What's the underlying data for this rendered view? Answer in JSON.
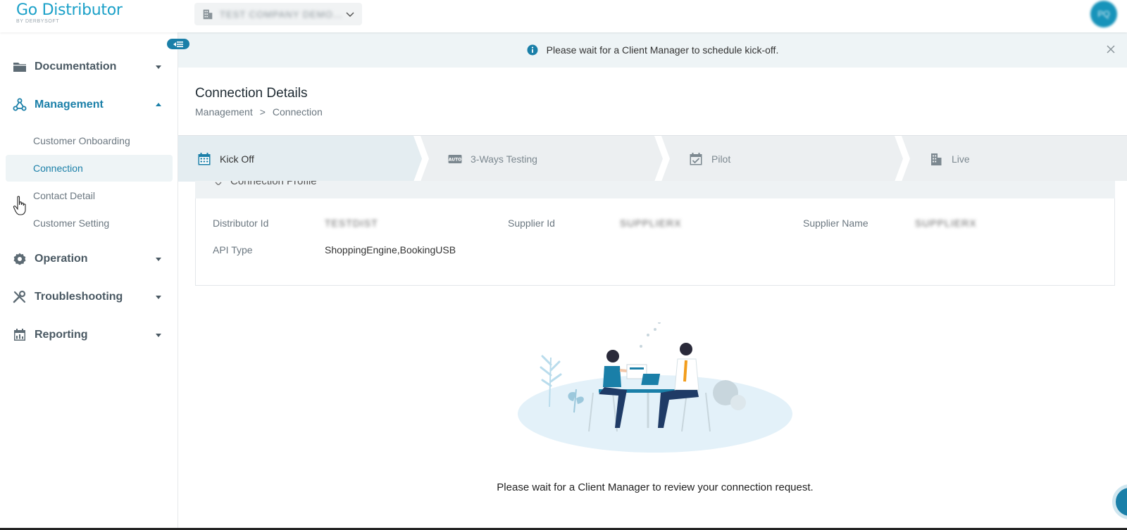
{
  "app": {
    "logo_main": "Go Distributor",
    "logo_sub": "BY DERBYSOFT",
    "company_selector": "TEST COMPANY DEMO...",
    "avatar_initials": "PQ"
  },
  "sidebar": {
    "groups": [
      {
        "label": "Documentation",
        "icon": "folder-icon",
        "expanded": false
      },
      {
        "label": "Management",
        "icon": "hub-icon",
        "expanded": true,
        "items": [
          "Customer Onboarding",
          "Connection",
          "Contact Detail",
          "Customer Setting"
        ],
        "active_item": "Connection"
      },
      {
        "label": "Operation",
        "icon": "gear-icon",
        "expanded": false
      },
      {
        "label": "Troubleshooting",
        "icon": "wrench-icon",
        "expanded": false
      },
      {
        "label": "Reporting",
        "icon": "calendar-chart-icon",
        "expanded": false
      }
    ]
  },
  "banner": {
    "message": "Please wait for a Client Manager to schedule kick-off."
  },
  "page": {
    "title": "Connection Details",
    "breadcrumb": [
      "Management",
      ">",
      "Connection"
    ]
  },
  "stepper": {
    "steps": [
      {
        "label": "Kick Off",
        "icon": "calendar-icon",
        "active": true
      },
      {
        "label": "3-Ways Testing",
        "icon": "auto-icon",
        "active": false
      },
      {
        "label": "Pilot",
        "icon": "calendar-check-icon",
        "active": false
      },
      {
        "label": "Live",
        "icon": "building-icon",
        "active": false
      }
    ],
    "auto_badge": "AUTO"
  },
  "profile": {
    "section_title": "Connection Profile",
    "fields": [
      {
        "label": "Distributor Id",
        "value": "TESTDIST"
      },
      {
        "label": "Supplier Id",
        "value": "SUPPLIERX"
      },
      {
        "label": "Supplier Name",
        "value": "SUPPLIERX"
      },
      {
        "label": "API Type",
        "value": "ShoppingEngine,BookingUSB"
      }
    ]
  },
  "empty_state": {
    "message": "Please wait for a Client Manager to review your connection request."
  },
  "colors": {
    "accent": "#1a7fa8",
    "logo": "#1aa0c8",
    "banner_bg": "#eef4f6",
    "stepper_bg": "#eceff1"
  }
}
